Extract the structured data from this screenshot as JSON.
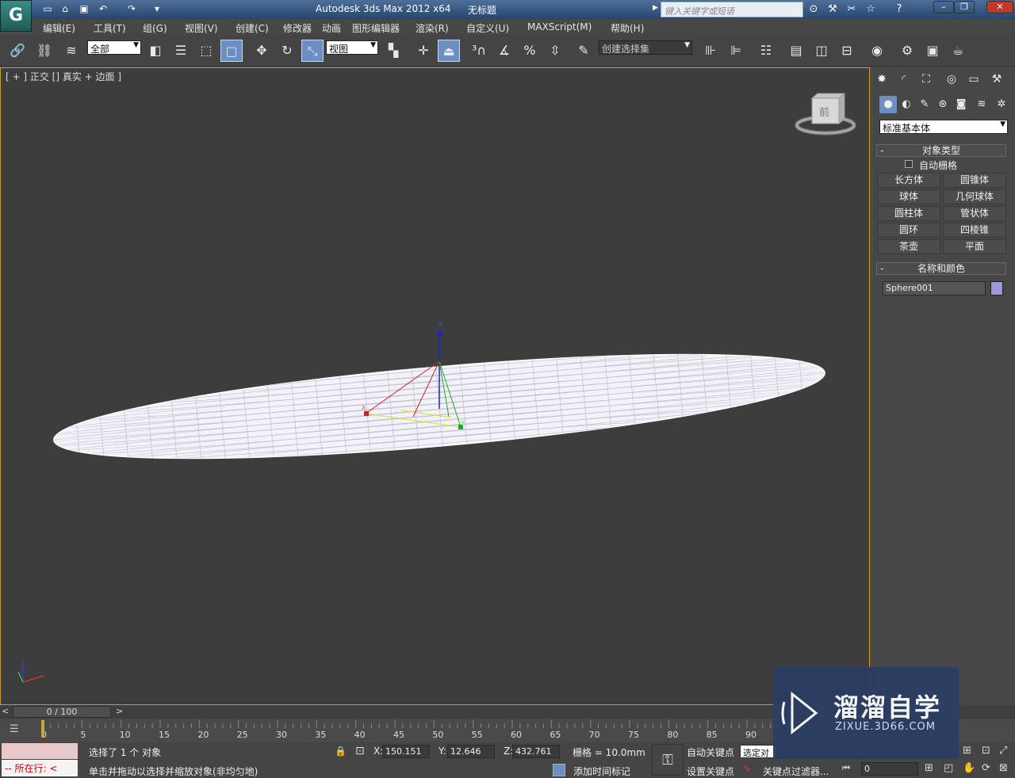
{
  "titlebar": {
    "app_name": "Autodesk 3ds Max  2012 x64",
    "document": "无标题",
    "search_placeholder": "键入关键字或短语",
    "logo_letter": "G"
  },
  "menu": [
    "编辑(E)",
    "工具(T)",
    "组(G)",
    "视图(V)",
    "创建(C)",
    "修改器",
    "动画",
    "图形编辑器",
    "渲染(R)",
    "自定义(U)",
    "MAXScript(M)",
    "帮助(H)"
  ],
  "toolbar": {
    "selection_filter": "全部",
    "ref_coord": "视图",
    "named_selection": "创建选择集"
  },
  "viewport": {
    "label": "[ + ] 正交 [] 真实 + 边面 ]",
    "viewcube_label": "前",
    "gizmo_axes": [
      "z",
      "x",
      "y"
    ]
  },
  "command_panel": {
    "category_dropdown": "标准基本体",
    "object_type": {
      "title": "对象类型",
      "autogrid_label": "自动栅格",
      "buttons": [
        "长方体",
        "圆锥体",
        "球体",
        "几何球体",
        "圆柱体",
        "管状体",
        "圆环",
        "四棱锥",
        "茶壶",
        "平面"
      ]
    },
    "name_color": {
      "title": "名称和颜色",
      "name_value": "Sphere001",
      "swatch_color": "#9a9ad8"
    }
  },
  "timeline": {
    "frame_display": "0 / 100",
    "ticks": [
      "0",
      "5",
      "10",
      "15",
      "20",
      "25",
      "30",
      "35",
      "40",
      "45",
      "50",
      "55",
      "60",
      "65",
      "70",
      "75",
      "80",
      "85",
      "90"
    ]
  },
  "status": {
    "selected_text": "选择了 1 个 对象",
    "prompt_text": "单击并拖动以选择并缩放对象(非均匀地)",
    "mode_label": "所在行:",
    "x_label": "X:",
    "x_value": "150.151",
    "y_label": "Y:",
    "y_value": "12.646",
    "z_label": "Z:",
    "z_value": "432.761",
    "grid": "栅格 = 10.0mm",
    "add_time_tag": "添加时间标记",
    "auto_key": "自动关键点",
    "set_key": "设置关键点",
    "selected_dropdown": "选定对",
    "key_filter": "关键点过滤器...",
    "frame_field": "0"
  },
  "watermark": {
    "brand": "溜溜自学",
    "url": "ZIXUE.3D66.COM"
  },
  "colors": {
    "viewport_bg": "#3d3d3d",
    "viewport_border": "#c79a2a",
    "active_blue": "#6b8fc2",
    "sphere_wire": "#ffffff"
  }
}
